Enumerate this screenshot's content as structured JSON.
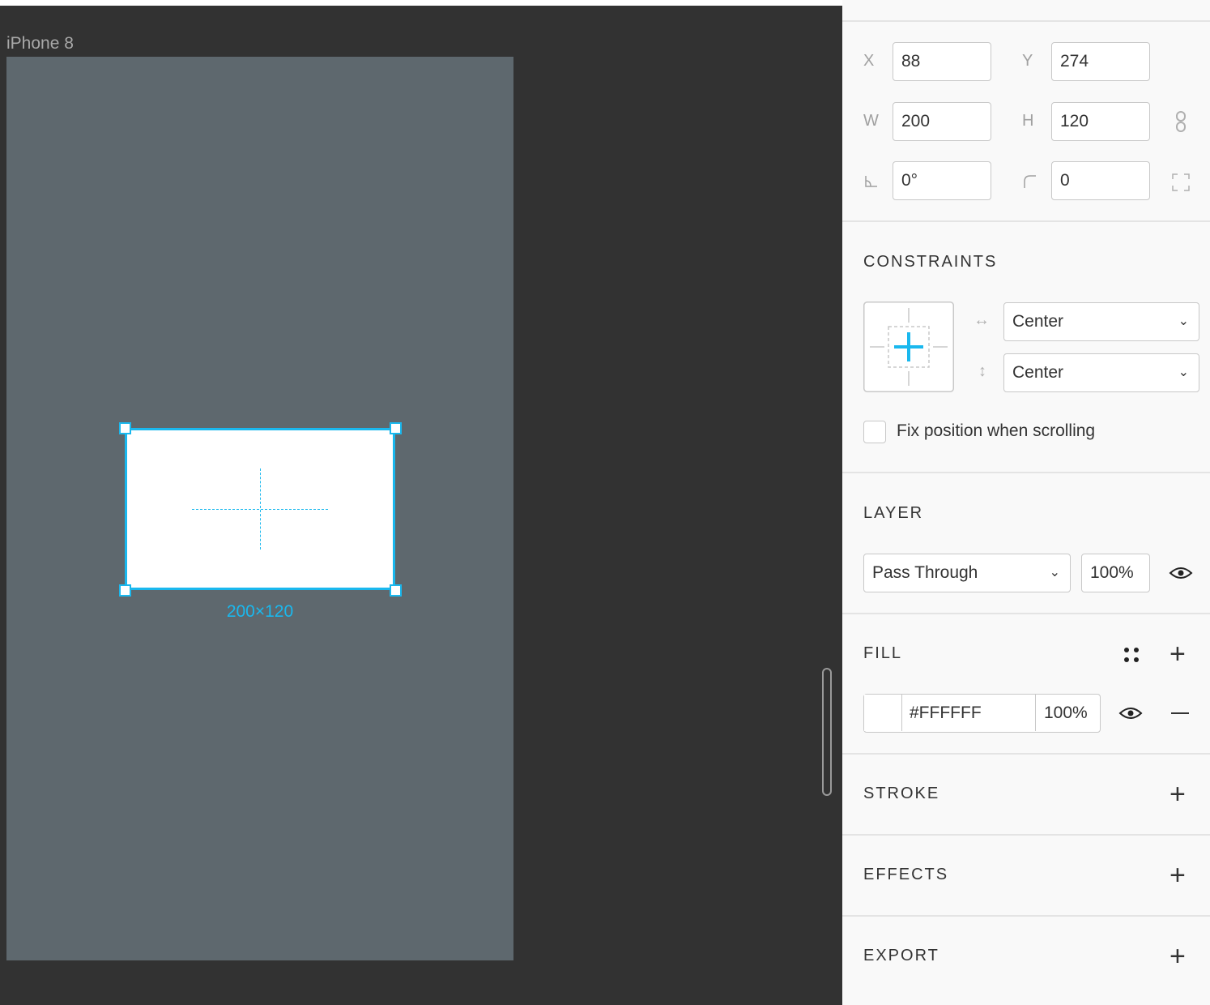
{
  "canvas": {
    "frame_label": "iPhone 8",
    "dimension_label": "200×120"
  },
  "transform": {
    "x_label": "X",
    "x_value": "88",
    "y_label": "Y",
    "y_value": "274",
    "w_label": "W",
    "w_value": "200",
    "h_label": "H",
    "h_value": "120",
    "rotation_value": "0°",
    "corner_radius_value": "0"
  },
  "constraints": {
    "title": "CONSTRAINTS",
    "horizontal": "Center",
    "vertical": "Center",
    "fix_position_label": "Fix position when scrolling",
    "fix_position_checked": false
  },
  "layer": {
    "title": "LAYER",
    "blend_mode": "Pass Through",
    "opacity": "100%"
  },
  "fill": {
    "title": "FILL",
    "color": "#FFFFFF",
    "hex_text": "#FFFFFF",
    "opacity": "100%"
  },
  "stroke": {
    "title": "STROKE"
  },
  "effects": {
    "title": "EFFECTS"
  },
  "export": {
    "title": "EXPORT"
  },
  "colors": {
    "accent": "#1ab8ee",
    "canvas_bg": "#323232",
    "frame_bg": "#5e686e",
    "panel_bg": "#f9f9f9"
  }
}
